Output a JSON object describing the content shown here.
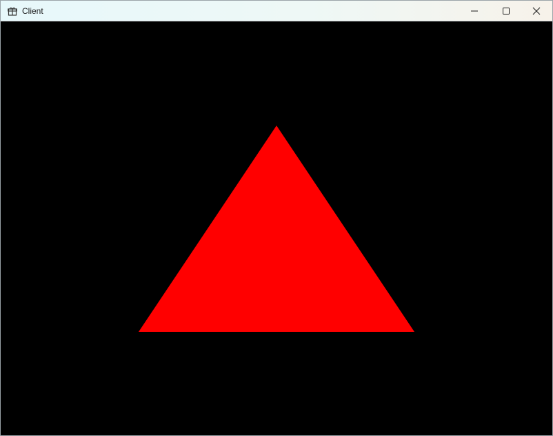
{
  "window": {
    "title": "Client",
    "app_icon": "gift-icon",
    "controls": {
      "minimize": "minimize-icon",
      "maximize": "maximize-icon",
      "close": "close-icon"
    }
  },
  "scene": {
    "background_color": "#000000",
    "triangle_color": "#ff0000"
  }
}
